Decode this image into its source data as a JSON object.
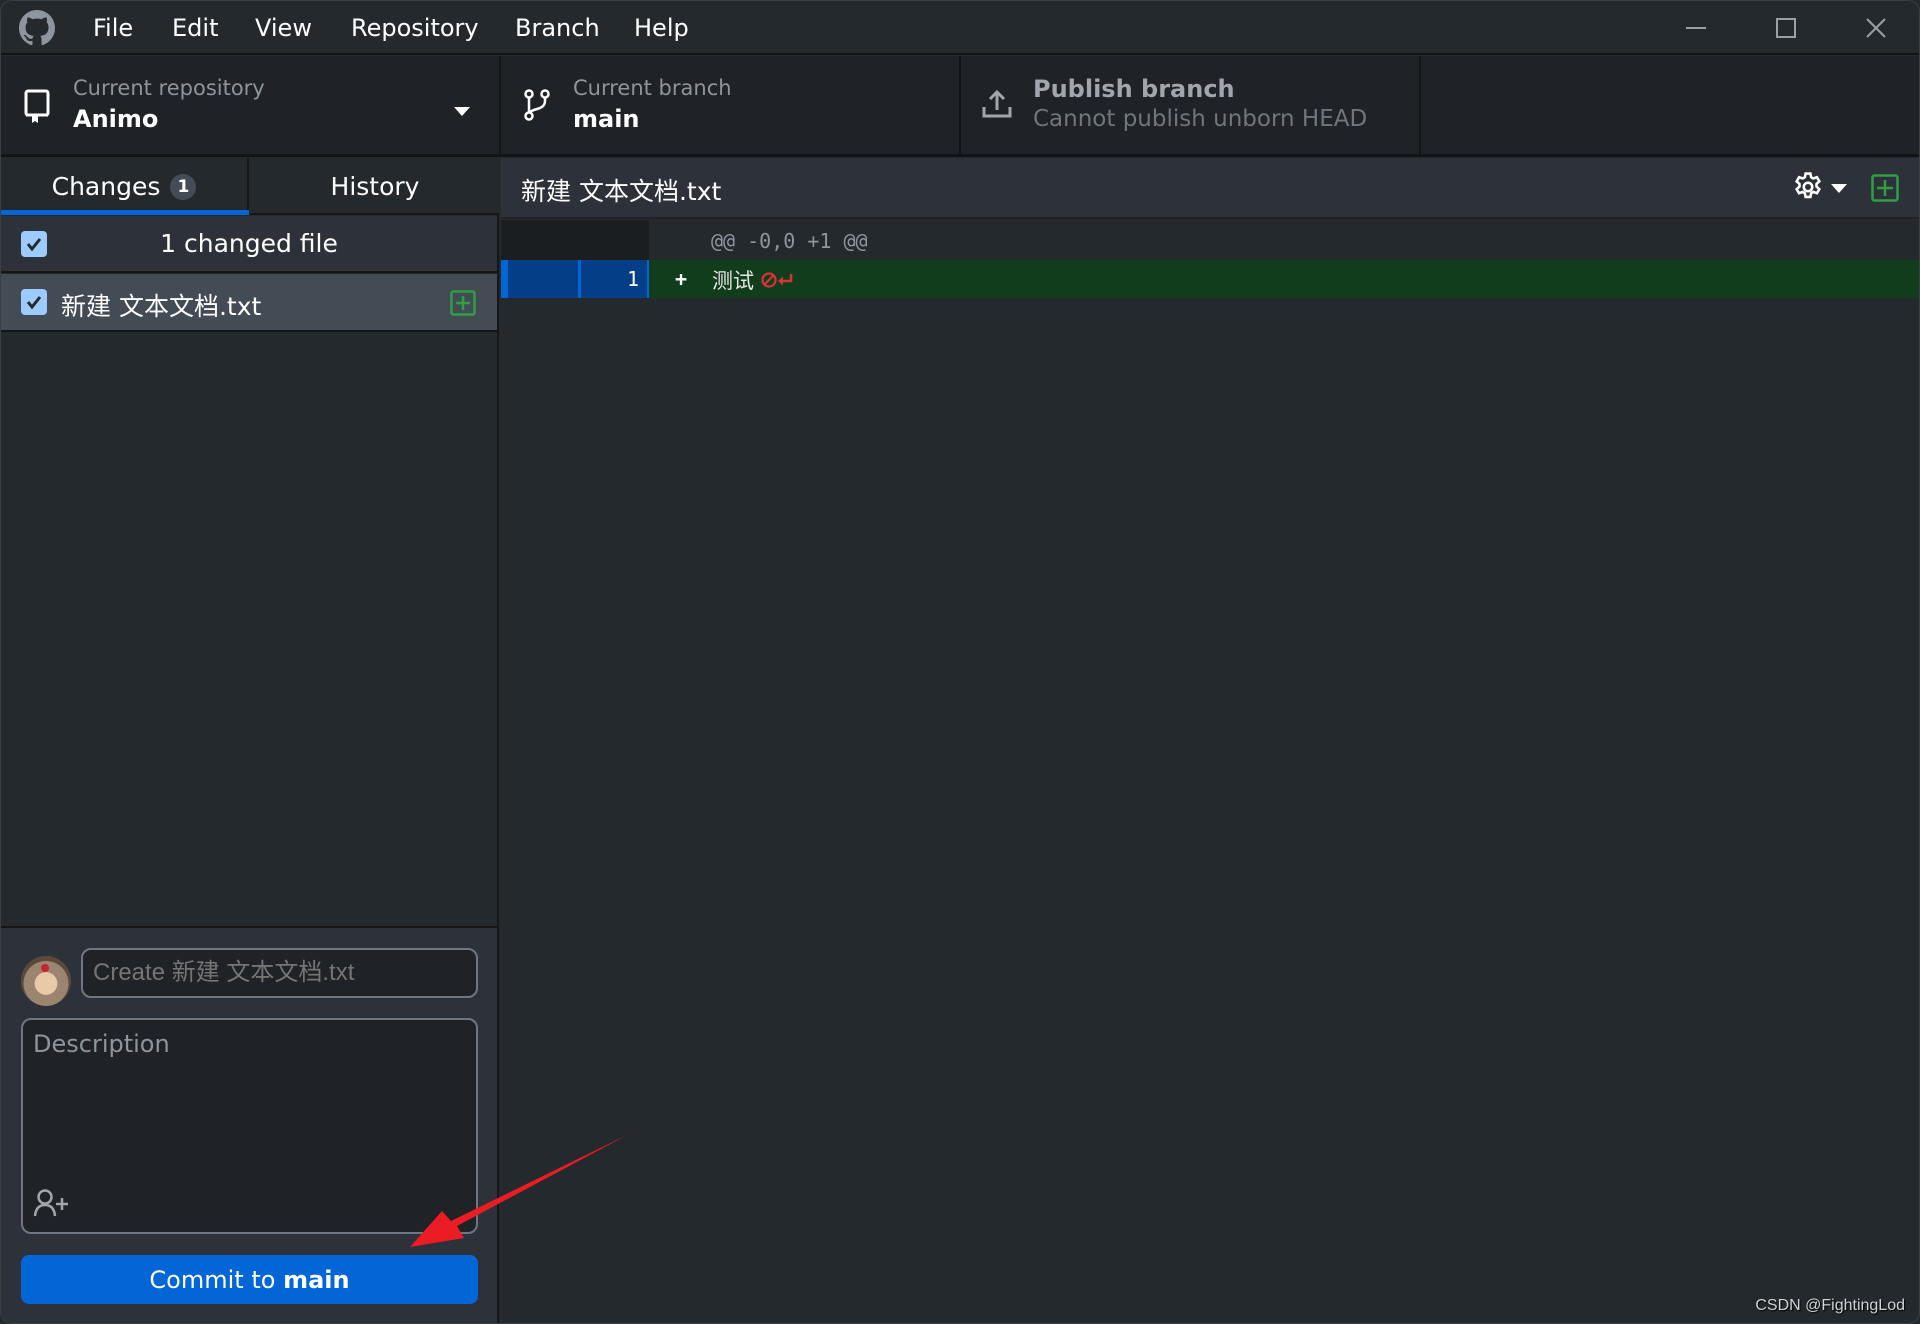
{
  "titlebar": {
    "menu": [
      "File",
      "Edit",
      "View",
      "Repository",
      "Branch",
      "Help"
    ],
    "controls": {
      "minimize": "minimize-icon",
      "maximize": "maximize-icon",
      "close": "close-icon"
    }
  },
  "toolbar": {
    "repository": {
      "label": "Current repository",
      "value": "Animo",
      "icon": "repo-icon"
    },
    "branch": {
      "label": "Current branch",
      "value": "main",
      "icon": "branch-icon"
    },
    "publish": {
      "label": "Publish branch",
      "value": "Cannot publish unborn HEAD",
      "icon": "upload-icon"
    }
  },
  "sidebar": {
    "tabs": [
      {
        "label": "Changes",
        "badge": "1",
        "active": true
      },
      {
        "label": "History",
        "active": false
      }
    ],
    "changes_header": {
      "label": "1 changed file",
      "checked": true
    },
    "files": [
      {
        "name": "新建 文本文档.txt",
        "checked": true,
        "status": "added",
        "status_icon": "file-added-icon"
      }
    ],
    "commit": {
      "summary_placeholder": "Create 新建 文本文档.txt",
      "description_placeholder": "Description",
      "button_prefix": "Commit to ",
      "button_branch": "main",
      "co_author_icon": "add-co-author-icon"
    }
  },
  "diff": {
    "filename": "新建 文本文档.txt",
    "hunk_header": "@@ -0,0 +1 @@",
    "lines": [
      {
        "old": "",
        "new": "1",
        "marker": "+",
        "text": "测试",
        "no_newline_icon": "no-newline-icon"
      }
    ]
  },
  "colors": {
    "accent": "#0366d6",
    "added_bg": "#113d1c",
    "gutter_added": "#043e86",
    "added_icon": "#2ea043",
    "annotation_arrow": "#ec1c24"
  },
  "watermark": "CSDN @FightingLod"
}
